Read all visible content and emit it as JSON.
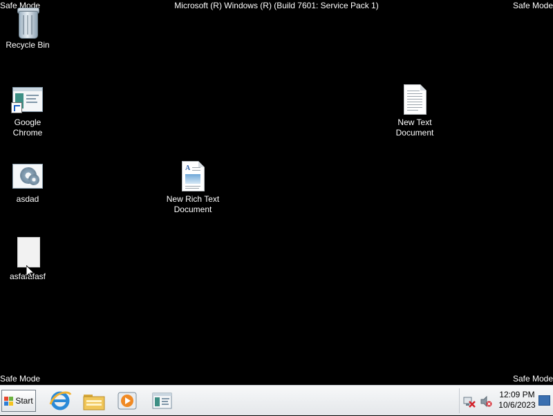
{
  "overlay": {
    "safe_mode_label": "Safe Mode",
    "os_title": "Microsoft (R) Windows (R) (Build 7601: Service Pack 1)"
  },
  "desktop_icons": [
    {
      "name": "recycle-bin",
      "label": "Recycle Bin",
      "icon": "recycle-bin-icon"
    },
    {
      "name": "google-chrome",
      "label": "Google Chrome",
      "icon": "application-shortcut-icon"
    },
    {
      "name": "asdad",
      "label": "asdad",
      "icon": "settings-window-icon"
    },
    {
      "name": "asfafafasf",
      "label": "asfafafasf",
      "icon": "blank-file-icon"
    },
    {
      "name": "new-rich-text-document",
      "label": "New Rich Text Document",
      "icon": "rich-text-document-icon"
    },
    {
      "name": "new-text-document",
      "label": "New Text Document",
      "icon": "text-document-icon"
    }
  ],
  "taskbar": {
    "start_label": "Start",
    "pinned": [
      {
        "name": "internet-explorer",
        "icon": "internet-explorer-icon"
      },
      {
        "name": "windows-explorer",
        "icon": "folder-icon"
      },
      {
        "name": "media-player",
        "icon": "media-player-icon"
      },
      {
        "name": "application-window",
        "icon": "application-window-icon"
      }
    ],
    "tray_icons": [
      "network-disconnected-icon",
      "volume-muted-icon"
    ],
    "clock": {
      "time": "12:09 PM",
      "date": "10/6/2023"
    }
  },
  "colors": {
    "desktop_background": "#000000",
    "taskbar_background": "#eef0f2",
    "text": "#ffffff"
  }
}
